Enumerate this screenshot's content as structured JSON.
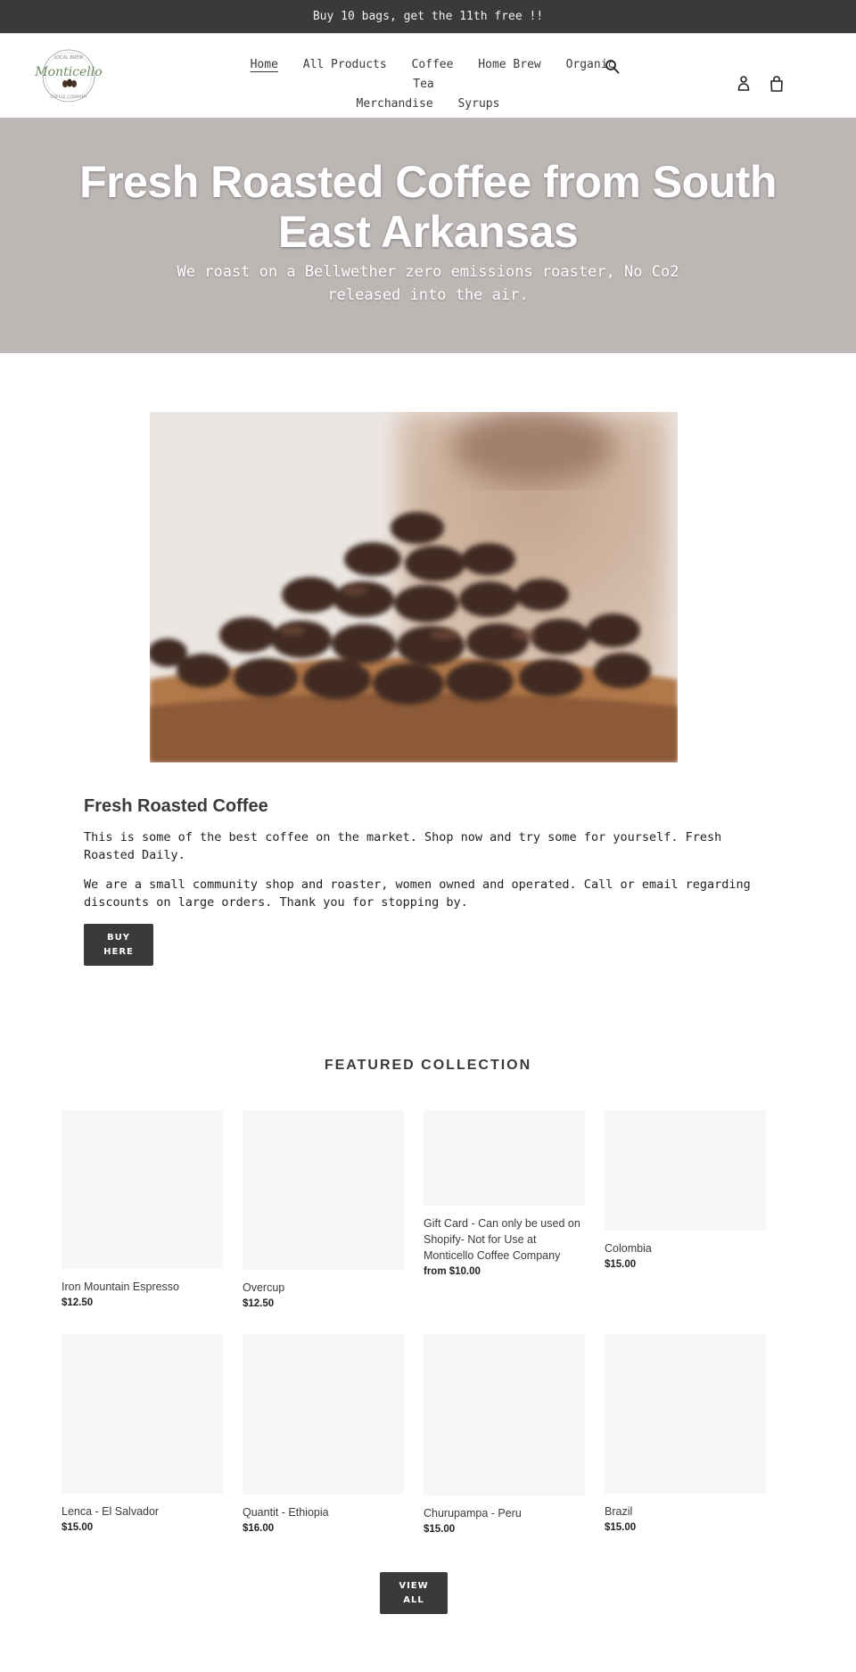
{
  "announcement": {
    "text": "Buy 10 bags, get the 11th free !!"
  },
  "header": {
    "logo_alt": "Monticello Coffee Company",
    "logo": {
      "top_text": "LOCAL BREW",
      "script_text": "Monticello",
      "bottom_text": "COFFEE COMPANY"
    },
    "nav_row1": [
      {
        "label": "Home",
        "active": true
      },
      {
        "label": "All Products"
      },
      {
        "label": "Coffee"
      },
      {
        "label": "Home Brew"
      },
      {
        "label": "Organic Tea"
      }
    ],
    "nav_row2": [
      {
        "label": "Merchandise"
      },
      {
        "label": "Syrups"
      }
    ],
    "icons": {
      "search": "search-icon",
      "account": "user-icon",
      "cart": "cart-icon"
    }
  },
  "hero": {
    "title": "Fresh Roasted Coffee from South East Arkansas",
    "subtitle": "We roast on a Bellwether zero emissions roaster, No Co2 released into the air.",
    "bg_color": "#bcb6b5"
  },
  "feature_image": {
    "alt": "Coffee beans in a wooden bowl"
  },
  "text_block": {
    "heading": "Fresh Roasted Coffee",
    "paragraph1": "This is some of the best coffee on the market. Shop now and try some for yourself. Fresh Roasted Daily.",
    "paragraph2": "We are a small community shop and roaster, women owned and operated. Call or email regarding discounts on large orders. Thank you for stopping by.",
    "button_line1": "BUY",
    "button_line2": "HERE"
  },
  "featured": {
    "title": "FEATURED COLLECTION",
    "products": [
      {
        "name": "Iron Mountain Espresso",
        "price": "$12.50"
      },
      {
        "name": "Overcup",
        "price": "$12.50"
      },
      {
        "name": "Gift Card - Can only be used on Shopify- Not for Use at Monticello Coffee Company",
        "price": "from $10.00"
      },
      {
        "name": "Colombia",
        "price": "$15.00"
      },
      {
        "name": "Lenca - El Salvador",
        "price": "$15.00"
      },
      {
        "name": "Quantit - Ethiopia",
        "price": "$16.00"
      },
      {
        "name": "Churupampa - Peru",
        "price": "$15.00"
      },
      {
        "name": "Brazil",
        "price": "$15.00"
      }
    ],
    "view_all_line1": "VIEW",
    "view_all_line2": "ALL"
  },
  "colors": {
    "dark": "#3a3a3a",
    "placeholder": "#f7f7f7"
  }
}
